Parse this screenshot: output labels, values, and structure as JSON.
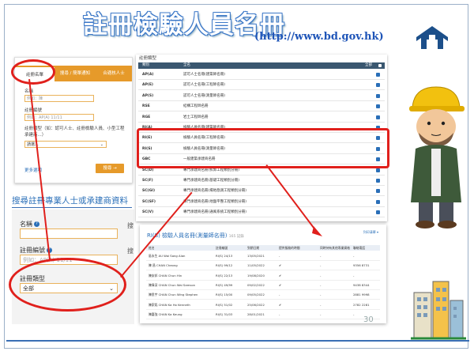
{
  "slide": {
    "title": "註冊檢驗人員名冊",
    "url": "(http://www.bd.gov.hk)",
    "page_number": "30"
  },
  "search_panel": {
    "tabs": [
      "註冊名單",
      "搜尋 / 簡單通知",
      "合適核人士"
    ],
    "name_label": "名稱",
    "name_placeholder": "例如：陳",
    "reg_no_label": "註冊編號",
    "reg_no_placeholder": "例如：AP(A) 11/11",
    "type_label": "註冊類型（如：認可人士、註冊檢驗人員、小型工程承建商...）",
    "type_value": "請選...",
    "more_link": "更多選項",
    "search_button": "搜尋"
  },
  "big_search": {
    "title": "搜尋註冊專業人士或承建商資料",
    "name_label": "名稱",
    "reg_no_label": "註冊編號",
    "reg_no_placeholder": "例如：AP(A) 11/11",
    "type_label": "註冊類型",
    "type_value": "全部",
    "side_label_1": "搜",
    "side_label_2": "搜"
  },
  "type_table": {
    "heading": "註冊類型",
    "col_category": "類別",
    "col_name": "全名",
    "col_select_all": "全部",
    "rows": [
      {
        "code": "AP(A)",
        "name": "認可人士名冊(建築師名冊)"
      },
      {
        "code": "AP(E)",
        "name": "認可人士名冊(工程師名冊)"
      },
      {
        "code": "AP(S)",
        "name": "認可人士名冊(測量師名冊)"
      },
      {
        "code": "RSE",
        "name": "結構工程師名冊"
      },
      {
        "code": "RGE",
        "name": "岩土工程師名冊"
      },
      {
        "code": "RI(A)",
        "name": "檢驗人員名冊(建築師名冊)"
      },
      {
        "code": "RI(E)",
        "name": "檢驗人員名冊(工程師名冊)"
      },
      {
        "code": "RI(S)",
        "name": "檢驗人員名冊(測量師名冊)"
      },
      {
        "code": "GBC",
        "name": "一般建築承建商名冊"
      },
      {
        "code": "SC(D)",
        "name": "專門承建商名冊(拆卸工程類別分冊)"
      },
      {
        "code": "SC(F)",
        "name": "專門承建商名冊(基礎工程類別分冊)"
      },
      {
        "code": "SC(GI)",
        "name": "專門承建商名冊(場地勘測工程類別分冊)"
      },
      {
        "code": "SC(SF)",
        "name": "專門承建商名冊(地盤平整工程類別分冊)"
      },
      {
        "code": "SC(V)",
        "name": "專門承建商名冊(通風系統工程類別分冊)"
      }
    ]
  },
  "results": {
    "title": "RI(S) 檢驗人員名冊(測量師名冊)",
    "count": "165 記錄",
    "link": "列印清單 ▾",
    "columns": [
      "姓名",
      "註冊編號",
      "到期日期",
      "提供服務的時間",
      "同時持有其他專業資格",
      "聯絡電話"
    ],
    "rows": [
      [
        "區永生 AU Wai Sang Alan",
        "RI(S) 24/13",
        "13/05/2021",
        "-",
        "-",
        "-"
      ],
      [
        "陳 昌 CHAN Cheong",
        "RI(S) 99/12",
        "11/05/2022",
        "✔",
        "-",
        "9356 8731"
      ],
      [
        "陳安邦 CHAN Chun Hin",
        "RI(S) 22/13",
        "19/08/2020",
        "✔",
        "-",
        "-"
      ],
      [
        "陳偉深 CHAN Chun Wai Samson",
        "RI(S) 49/99",
        "09/02/2022",
        "✔",
        "-",
        "9438 8344"
      ],
      [
        "陳思宇 CHAN Chun Wing Stephen",
        "RI(S) 15/00",
        "09/05/2022",
        "-",
        "-",
        "2881 9998"
      ],
      [
        "陳家銘 CHAN Ka Ho Kenneth",
        "RI(S) 51/02",
        "25/06/2022",
        "✔",
        "-",
        "2782 2281"
      ],
      [
        "陳嘉強 CHAN Ka Keung",
        "RI(S) 31/03",
        "28/01/2021",
        "-",
        "-",
        "-"
      ]
    ]
  },
  "colors": {
    "title_outline": "#3c78c8",
    "url": "#1f55b8",
    "highlight": "#e0201c",
    "tab_accent": "#e69a2a",
    "table_header": "#3a5770"
  }
}
